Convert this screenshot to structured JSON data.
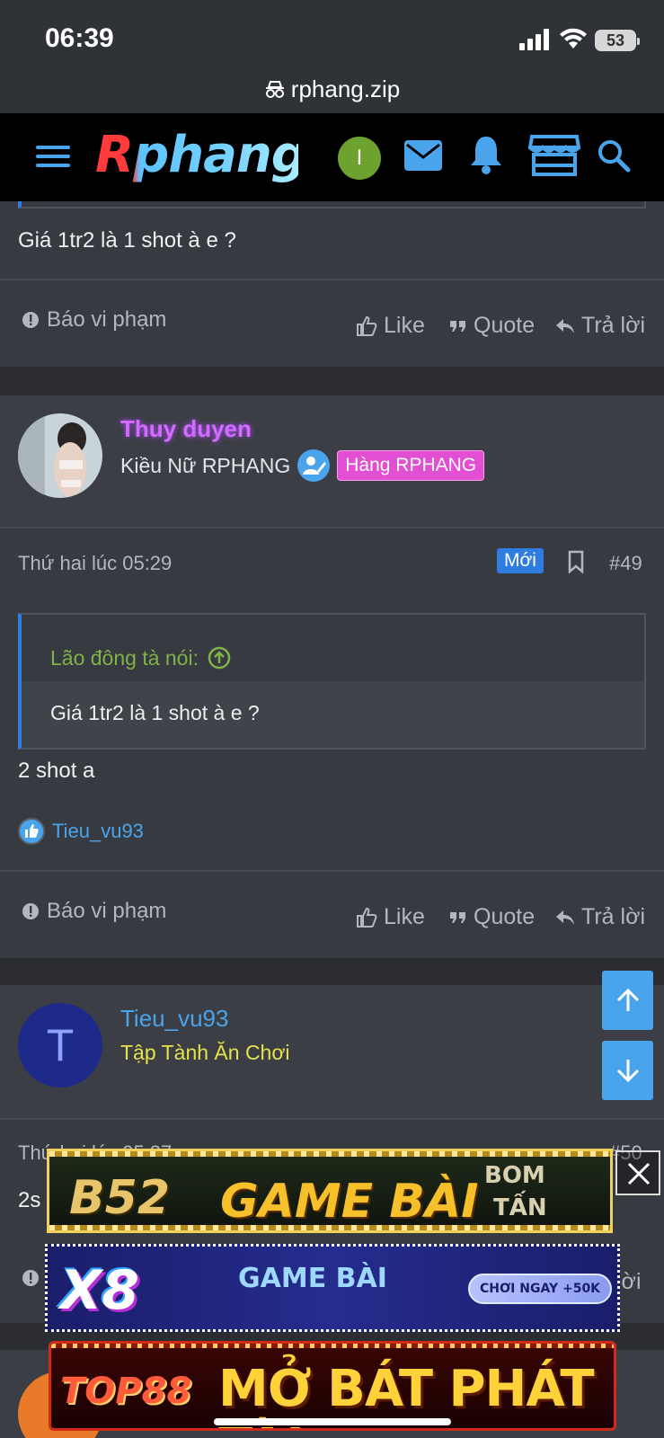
{
  "status_bar": {
    "time": "06:39",
    "battery": "53"
  },
  "url_bar": {
    "url": "rphang.zip"
  },
  "header": {
    "logo_text": "Rphang",
    "user_initial": "I"
  },
  "prev_post": {
    "text": "Giá 1tr2 là 1 shot à e ?",
    "report": "Báo vi phạm",
    "like": "Like",
    "quote": "Quote",
    "reply": "Trả lời"
  },
  "post49": {
    "username": "Thuy duyen",
    "user_title": "Kiều Nữ RPHANG",
    "rank_badge": "Hàng RPHANG",
    "date": "Thứ hai lúc 05:29",
    "new_badge": "Mới",
    "post_number": "#49",
    "quote_author": "Lão đông tà nói:",
    "quote_text": "Giá 1tr2 là 1 shot à e ?",
    "text": "2 shot a",
    "liked_by": "Tieu_vu93",
    "report": "Báo vi phạm",
    "like": "Like",
    "quote": "Quote",
    "reply": "Trả lời"
  },
  "post50": {
    "avatar_letter": "T",
    "username": "Tieu_vu93",
    "user_title": "Tập Tành Ăn Chơi",
    "date_partial": "Thứ hai lúc 05:37",
    "post_number": "#50",
    "text_partial": "2s",
    "reply_partial": "lời"
  },
  "ads": {
    "b52_brand": "B52",
    "b52_text": "GAME BÀI",
    "b52_side_1": "BOM",
    "b52_side_2": "TẤN",
    "x8_brand": "X8",
    "x8_text": "GAME BÀI",
    "x8_cta": "CHƠI NGAY +50K",
    "top88_brand": "TOP88",
    "top88_text": "MỞ BÁT PHÁT TÀI"
  },
  "colors": {
    "link_blue": "#4aa4ec",
    "username_purple": "#d46bff",
    "rank_pink": "#e24fd3",
    "title_yellow": "#e8e24a",
    "quote_green": "#7fb347",
    "new_badge_blue": "#2f7de1"
  }
}
